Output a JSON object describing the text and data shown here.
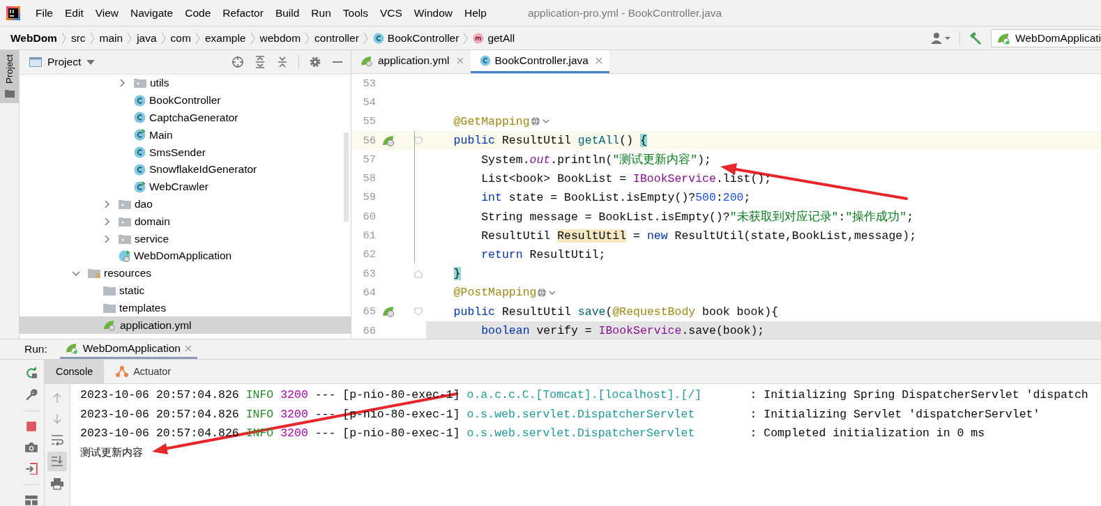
{
  "menu": {
    "items": [
      "File",
      "Edit",
      "View",
      "Navigate",
      "Code",
      "Refactor",
      "Build",
      "Run",
      "Tools",
      "VCS",
      "Window",
      "Help"
    ],
    "title": "application-pro.yml - BookController.java"
  },
  "breadcrumbs": [
    {
      "label": "WebDom",
      "kind": "project"
    },
    {
      "label": "src",
      "kind": "folder"
    },
    {
      "label": "main",
      "kind": "folder"
    },
    {
      "label": "java",
      "kind": "folder"
    },
    {
      "label": "com",
      "kind": "folder"
    },
    {
      "label": "example",
      "kind": "folder"
    },
    {
      "label": "webdom",
      "kind": "folder"
    },
    {
      "label": "controller",
      "kind": "folder"
    },
    {
      "label": "BookController",
      "kind": "class"
    },
    {
      "label": "getAll",
      "kind": "method"
    }
  ],
  "run_config": {
    "label": "WebDomApplicati"
  },
  "side_strip": {
    "label": "Project"
  },
  "project": {
    "title": "Project",
    "tree": [
      {
        "children": [
          {
            "children": [
              {
                "children": [
                  {
                    "label": "utils",
                    "kind": "package",
                    "expanded": false,
                    "selected": false
                  },
                  {
                    "label": "BookController",
                    "kind": "class",
                    "selected": false
                  },
                  {
                    "label": "CaptchaGenerator",
                    "kind": "class",
                    "selected": false
                  },
                  {
                    "label": "Main",
                    "kind": "main",
                    "selected": false
                  },
                  {
                    "label": "SmsSender",
                    "kind": "class",
                    "selected": false
                  },
                  {
                    "label": "SnowflakeIdGenerator",
                    "kind": "class",
                    "selected": false
                  },
                  {
                    "label": "WebCrawler",
                    "kind": "main",
                    "selected": false
                  }
                ]
              },
              {
                "label": "dao",
                "kind": "package",
                "expanded": false,
                "selected": false
              },
              {
                "label": "domain",
                "kind": "package",
                "expanded": false,
                "selected": false
              },
              {
                "label": "service",
                "kind": "package",
                "expanded": false,
                "selected": false
              },
              {
                "label": "WebDomApplication",
                "kind": "spring",
                "selected": false
              }
            ]
          }
        ]
      },
      {
        "label": "resources",
        "kind": "resources",
        "expanded": true,
        "selected": false,
        "children": [
          {
            "label": "static",
            "kind": "folder",
            "selected": false
          },
          {
            "label": "templates",
            "kind": "folder",
            "selected": false
          },
          {
            "label": "application.yml",
            "kind": "yml",
            "selected": true
          }
        ]
      }
    ]
  },
  "editor": {
    "tabs": [
      {
        "label": "application.yml",
        "kind": "yml",
        "selected": false
      },
      {
        "label": "BookController.java",
        "kind": "class",
        "selected": true
      }
    ],
    "lines": [
      {
        "number": "53"
      },
      {
        "number": "54"
      },
      {
        "number": "55",
        "inlay": true,
        "tokens": [
          {
            "text": "    @GetMapping",
            "kind": "ann"
          }
        ]
      },
      {
        "number": "56",
        "caret_line": true,
        "gutter_icon": true,
        "fold_start": true,
        "tokens": [
          {
            "text": "    public",
            "kind": "kw"
          },
          {
            "text": " ResultUtil ",
            "kind": "plain"
          },
          {
            "text": "getAll",
            "kind": "fn"
          },
          {
            "text": "() ",
            "kind": "plain"
          },
          {
            "text": "{",
            "kind": "brace"
          }
        ]
      },
      {
        "number": "57",
        "tokens": [
          {
            "text": "        System.",
            "kind": "plain"
          },
          {
            "text": "out",
            "kind": "field"
          },
          {
            "text": ".println(",
            "kind": "plain"
          },
          {
            "text": "\"测试更新内容\"",
            "kind": "str"
          },
          {
            "text": ");",
            "kind": "plain"
          }
        ]
      },
      {
        "number": "58",
        "tokens": [
          {
            "text": "        List<book> BookList = ",
            "kind": "plain"
          },
          {
            "text": "IBookService",
            "kind": "svc"
          },
          {
            "text": ".list();",
            "kind": "plain"
          }
        ]
      },
      {
        "number": "59",
        "tokens": [
          {
            "text": "        int",
            "kind": "kw"
          },
          {
            "text": " state = BookList.isEmpty()?",
            "kind": "plain"
          },
          {
            "text": "500",
            "kind": "num"
          },
          {
            "text": ":",
            "kind": "plain"
          },
          {
            "text": "200",
            "kind": "num"
          },
          {
            "text": ";",
            "kind": "plain"
          }
        ]
      },
      {
        "number": "60",
        "tokens": [
          {
            "text": "        String message = BookList.isEmpty()?",
            "kind": "plain"
          },
          {
            "text": "\"未获取到对应记录\"",
            "kind": "str"
          },
          {
            "text": ":",
            "kind": "plain"
          },
          {
            "text": "\"操作成功\"",
            "kind": "str"
          },
          {
            "text": ";",
            "kind": "plain"
          }
        ]
      },
      {
        "number": "61",
        "tokens": [
          {
            "text": "        ResultUtil ",
            "kind": "plain"
          },
          {
            "text": "ResultUtil",
            "kind": "usage"
          },
          {
            "text": " = ",
            "kind": "plain"
          },
          {
            "text": "new",
            "kind": "kw"
          },
          {
            "text": " ResultUtil(state,BookList,message);",
            "kind": "plain"
          }
        ]
      },
      {
        "number": "62",
        "tokens": [
          {
            "text": "        return",
            "kind": "kw"
          },
          {
            "text": " ResultUtil;",
            "kind": "plain"
          }
        ]
      },
      {
        "number": "63",
        "fold_end": true,
        "tokens": [
          {
            "text": "    }",
            "kind": "brace"
          }
        ]
      },
      {
        "number": "64",
        "inlay": true,
        "tokens": [
          {
            "text": "    @PostMapping",
            "kind": "ann"
          }
        ]
      },
      {
        "number": "65",
        "gutter_icon": true,
        "fold_start": true,
        "tokens": [
          {
            "text": "    public",
            "kind": "kw"
          },
          {
            "text": " ResultUtil ",
            "kind": "plain"
          },
          {
            "text": "save",
            "kind": "fn"
          },
          {
            "text": "(",
            "kind": "plain"
          },
          {
            "text": "@RequestBody",
            "kind": "ann"
          },
          {
            "text": " book book){",
            "kind": "plain"
          }
        ]
      },
      {
        "number": "66",
        "selected_line": true,
        "tokens": [
          {
            "text": "        boolean",
            "kind": "kw"
          },
          {
            "text": " verify = ",
            "kind": "plain"
          },
          {
            "text": "IBookService",
            "kind": "svc"
          },
          {
            "text": ".save(book);",
            "kind": "plain"
          }
        ]
      }
    ]
  },
  "run": {
    "label": "Run:",
    "tab": "WebDomApplication",
    "tabs": [
      {
        "label": "Console",
        "selected": true
      },
      {
        "label": "Actuator",
        "selected": false
      }
    ],
    "lines": [
      {
        "kind": "log",
        "time": "2023-10-06 20:57:04.826",
        "level": "INFO",
        "pid": "3200",
        "separator": "---",
        "thread": "[p-nio-80-exec-1]",
        "logger": "o.a.c.c.C.[Tomcat].[localhost].[/]",
        "message": ": Initializing Spring DispatcherServlet 'dispatch"
      },
      {
        "kind": "log",
        "time": "2023-10-06 20:57:04.826",
        "level": "INFO",
        "pid": "3200",
        "separator": "---",
        "thread": "[p-nio-80-exec-1]",
        "logger": "o.s.web.servlet.DispatcherServlet",
        "message": ": Initializing Servlet 'dispatcherServlet'"
      },
      {
        "kind": "log",
        "time": "2023-10-06 20:57:04.826",
        "level": "INFO",
        "pid": "3200",
        "separator": "---",
        "thread": "[p-nio-80-exec-1]",
        "logger": "o.s.web.servlet.DispatcherServlet",
        "message": ": Completed initialization in 0 ms"
      },
      {
        "kind": "output",
        "text": "测试更新内容"
      }
    ]
  }
}
